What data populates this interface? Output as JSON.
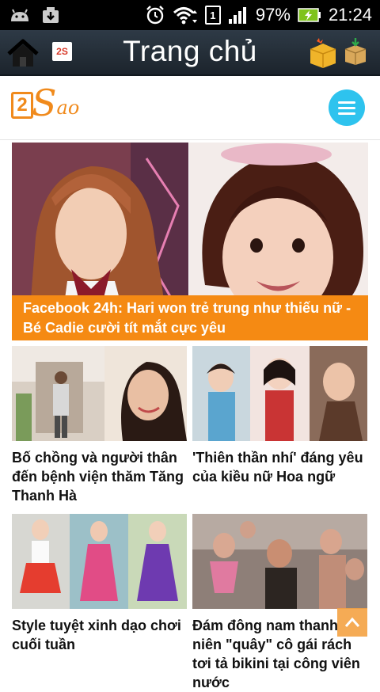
{
  "status_bar": {
    "battery": "97%",
    "time": "21:24",
    "sim": "1",
    "icons": [
      "android-icon",
      "download-icon",
      "alarm-icon",
      "wifi-icon",
      "signal-icon",
      "battery-charging-icon"
    ]
  },
  "app_bar": {
    "title": "Trang chủ",
    "logo_text": "2S",
    "icons": [
      "home-icon",
      "gift-box-icon",
      "box-download-icon"
    ]
  },
  "site_header": {
    "brand_number": "2",
    "brand_s": "S",
    "brand_rest": "ao",
    "menu_icon": "hamburger-menu-icon"
  },
  "hero": {
    "caption": "Facebook 24h: Hari won trẻ trung như thiếu nữ - Bé Cadie cười tít mắt cực yêu"
  },
  "articles": [
    {
      "title": "Bố chồng và người thân đến bệnh viện thăm Tăng Thanh Hà"
    },
    {
      "title": "'Thiên thần nhí' đáng yêu của kiều nữ Hoa ngữ"
    },
    {
      "title": "Style tuyệt xinh dạo chơi cuối tuần"
    },
    {
      "title": "Đám đông nam thanh niên \"quây\" cô gái rách tơi tả bikini tại công viên nước"
    }
  ],
  "colors": {
    "accent_orange": "#f58a13",
    "menu_blue": "#2ec3ee",
    "appbar_dark": "#1c242c"
  }
}
